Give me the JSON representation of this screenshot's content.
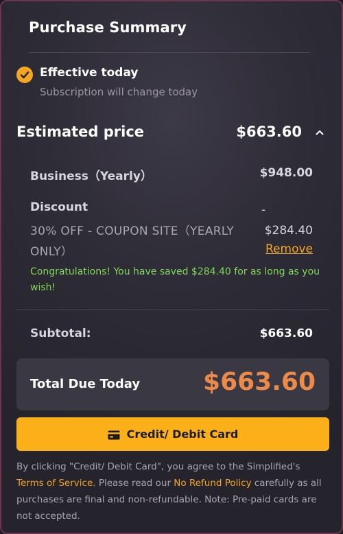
{
  "title": "Purchase Summary",
  "effective": {
    "title": "Effective today",
    "subtitle": "Subscription will change today",
    "icon": "check-circle-icon"
  },
  "estimate": {
    "label": "Estimated price",
    "value": "$663.60",
    "icon": "chevron-up-icon"
  },
  "plan": {
    "label": "Business（Yearly）",
    "value": "$948.00"
  },
  "discount": {
    "label": "Discount",
    "coupon": "30% OFF - COUPON SITE（YEARLY ONLY）",
    "sign": "-",
    "amount": "$284.40",
    "remove_label": "Remove"
  },
  "congrats_message": "Congratulations! You have saved $284.40 for as long as you wish!",
  "subtotal": {
    "label": "Subtotal:",
    "value": "$663.60"
  },
  "total": {
    "label": "Total Due Today",
    "value": "$663.60"
  },
  "pay_button": {
    "label": "Credit/ Debit Card",
    "icon": "credit-card-icon"
  },
  "legal": {
    "part1": "By clicking \"Credit/ Debit Card\", you agree to the Simplified's",
    "terms_link": "Terms of Service.",
    "part2": " Please read our ",
    "refund_link": "No Refund Policy",
    "part3": " carefully as all purchases are final and non-refundable. Note: Pre-paid cards are not accepted."
  },
  "colors": {
    "accent": "#fbb01a",
    "total_value": "#ec8a4a",
    "success_text": "#7ed957",
    "panel_border": "#6b3550"
  }
}
